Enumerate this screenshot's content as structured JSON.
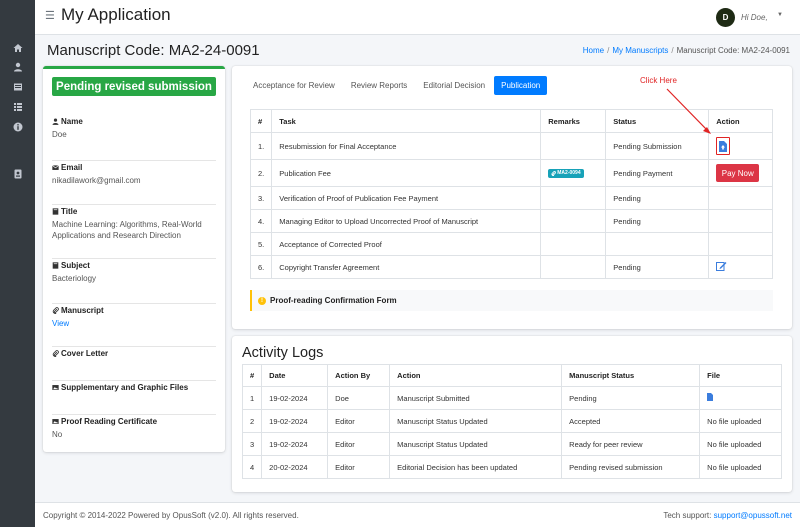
{
  "app": {
    "title": "My Application",
    "user_greeting": "Hi Doe,",
    "avatar_initial": "D"
  },
  "sidebar": {
    "icons": [
      "home-icon",
      "user-icon",
      "inbox-icon",
      "list-icon",
      "info-icon",
      "id-card-icon"
    ]
  },
  "page": {
    "title": "Manuscript Code: MA2-24-0091"
  },
  "breadcrumb": {
    "home": "Home",
    "manuscripts": "My Manuscripts",
    "current": "Manuscript Code: MA2-24-0091"
  },
  "details": {
    "status": "Pending revised submission",
    "name_label": "Name",
    "name": "Doe",
    "email_label": "Email",
    "email": "nikadilawork@gmail.com",
    "title_label": "Title",
    "title": "Machine Learning: Algorithms, Real-World Applications and Research Direction",
    "subject_label": "Subject",
    "subject": "Bacteriology",
    "manuscript_label": "Manuscript",
    "manuscript_link": "View",
    "cover_letter_label": "Cover Letter",
    "supplementary_label": "Supplementary and Graphic Files",
    "proof_cert_label": "Proof Reading Certificate",
    "proof_cert": "No"
  },
  "tabs": [
    {
      "label": "Acceptance for Review",
      "active": false
    },
    {
      "label": "Review Reports",
      "active": false
    },
    {
      "label": "Editorial Decision",
      "active": false
    },
    {
      "label": "Publication",
      "active": true
    }
  ],
  "task_table": {
    "headers": [
      "#",
      "Task",
      "Remarks",
      "Status",
      "Action"
    ],
    "rows": [
      {
        "num": "1.",
        "task": "Resubmission for Final Acceptance",
        "remarks": "",
        "status": "Pending Submission",
        "action": "upload"
      },
      {
        "num": "2.",
        "task": "Publication Fee",
        "remarks": "MA2-0094",
        "status": "Pending Payment",
        "action": "pay"
      },
      {
        "num": "3.",
        "task": "Verification of Proof of Publication Fee Payment",
        "remarks": "",
        "status": "Pending",
        "action": ""
      },
      {
        "num": "4.",
        "task": "Managing Editor to Upload Uncorrected Proof of Manuscript",
        "remarks": "",
        "status": "Pending",
        "action": ""
      },
      {
        "num": "5.",
        "task": "Acceptance of Corrected Proof",
        "remarks": "",
        "status": "",
        "action": ""
      },
      {
        "num": "6.",
        "task": "Copyright Transfer Agreement",
        "remarks": "",
        "status": "Pending",
        "action": "edit"
      }
    ],
    "pay_label": "Pay Now"
  },
  "callout": {
    "text": "Proof-reading Confirmation Form"
  },
  "annotation": {
    "text": "Click Here",
    "color": "#e02424"
  },
  "activity": {
    "title": "Activity Logs",
    "headers": [
      "#",
      "Date",
      "Action By",
      "Action",
      "Manuscript Status",
      "File"
    ],
    "rows": [
      {
        "num": "1",
        "date": "19-02-2024",
        "by": "Doe",
        "action": "Manuscript Submitted",
        "status": "Pending",
        "file": ""
      },
      {
        "num": "2",
        "date": "19-02-2024",
        "by": "Editor",
        "action": "Manuscript Status Updated",
        "status": "Accepted",
        "file": "No file uploaded"
      },
      {
        "num": "3",
        "date": "19-02-2024",
        "by": "Editor",
        "action": "Manuscript Status Updated",
        "status": "Ready for peer review",
        "file": "No file uploaded"
      },
      {
        "num": "4",
        "date": "20-02-2024",
        "by": "Editor",
        "action": "Editorial Decision has been updated",
        "status": "Pending revised submission",
        "file": "No file uploaded"
      }
    ]
  },
  "footer": {
    "copyright": "Copyright © 2014-2022 Powered by OpusSoft (v2.0). All rights reserved.",
    "support_label": "Tech support:",
    "support_email": "support@opussoft.net"
  },
  "colors": {
    "success": "#28a745",
    "primary": "#007bff",
    "danger": "#dc3545",
    "sidebar": "#343a40",
    "warning": "#ffc107",
    "info": "#17a2b8"
  }
}
